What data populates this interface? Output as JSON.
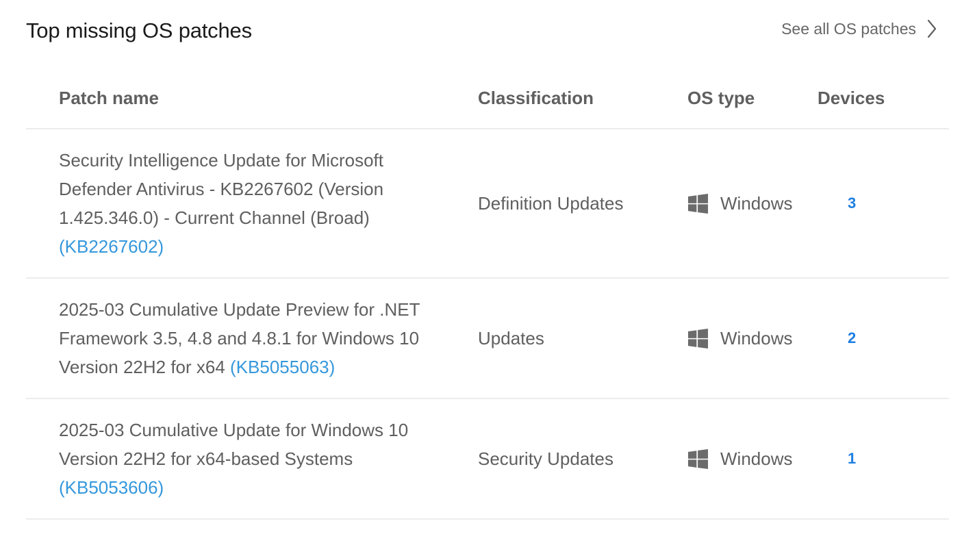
{
  "widget": {
    "title": "Top missing OS patches",
    "see_all_label": "See all OS patches"
  },
  "table": {
    "columns": {
      "patch_name": "Patch name",
      "classification": "Classification",
      "os_type": "OS type",
      "devices": "Devices"
    },
    "rows": [
      {
        "name": "Security Intelligence Update for Microsoft Defender Antivirus - KB2267602 (Version 1.425.346.0) - Current Channel (Broad)",
        "kb": "(KB2267602)",
        "classification": "Definition Updates",
        "os_icon": "windows-icon",
        "os": "Windows",
        "devices": "3"
      },
      {
        "name": "2025-03 Cumulative Update Preview for .NET Framework 3.5, 4.8 and 4.8.1 for Windows 10 Version 22H2 for x64",
        "kb": "(KB5055063)",
        "classification": "Updates",
        "os_icon": "windows-icon",
        "os": "Windows",
        "devices": "2"
      },
      {
        "name": "2025-03 Cumulative Update for Windows 10 Version 22H2 for x64-based Systems",
        "kb": "(KB5053606)",
        "classification": "Security Updates",
        "os_icon": "windows-icon",
        "os": "Windows",
        "devices": "1"
      }
    ]
  },
  "colors": {
    "link": "#3598dc",
    "device_count": "#1e7fe0",
    "text": "#5f5f5f",
    "title": "#1b1b1b",
    "divider": "#ececec"
  }
}
